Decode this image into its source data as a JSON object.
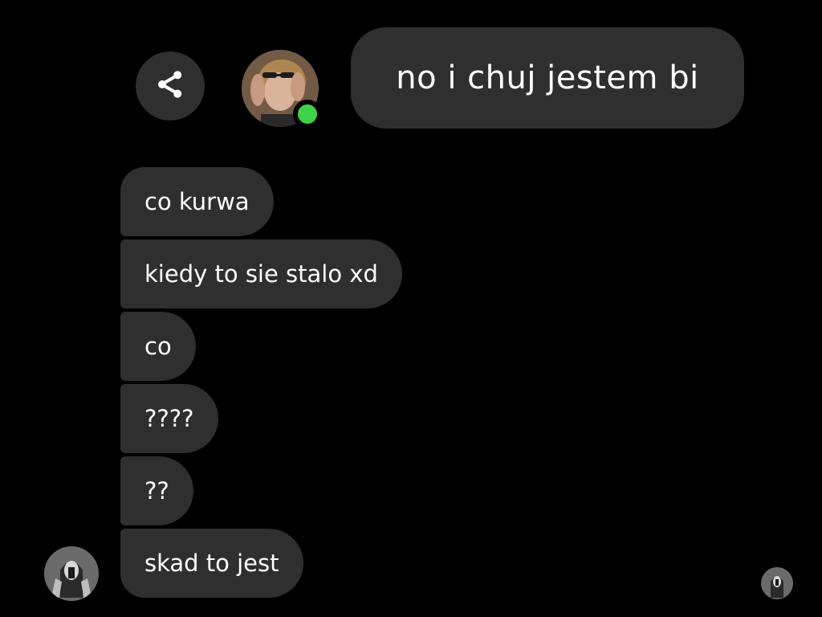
{
  "conversation": {
    "outgoing": [
      {
        "text": "no i chuj jestem bi"
      }
    ],
    "incoming": [
      {
        "text": "co kurwa"
      },
      {
        "text": "kiedy to sie stalo xd"
      },
      {
        "text": "co"
      },
      {
        "text": "????"
      },
      {
        "text": "??"
      },
      {
        "text": "skad to jest"
      }
    ]
  },
  "icons": {
    "share": "share-icon",
    "online": "online-status-dot"
  },
  "colors": {
    "background": "#000000",
    "bubble": "#2f2f2f",
    "online": "#3fd14a",
    "text": "#ffffff"
  }
}
